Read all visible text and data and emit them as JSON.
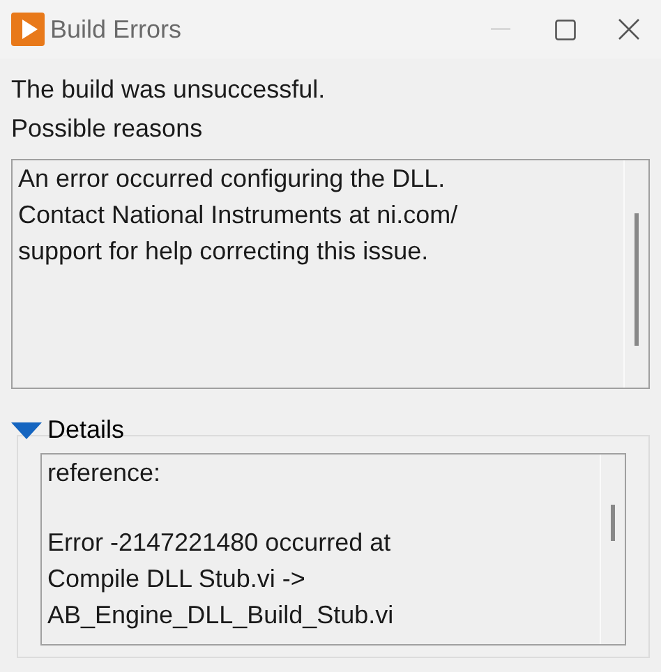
{
  "window": {
    "title": "Build Errors",
    "title_buttons": [
      {
        "kind": "minimize",
        "disabled": true
      },
      {
        "kind": "maximize",
        "disabled": false
      },
      {
        "kind": "close",
        "disabled": false
      }
    ]
  },
  "message": [
    "The build was unsuccessful.",
    "Possible reasons"
  ],
  "reasons_box": {
    "paragraphs": [
      {
        "lines": [
          "An error occurred configuring the DLL.",
          "Contact National Instruments at ni.com/",
          "support for help correcting this issue."
        ]
      }
    ]
  },
  "details": {
    "label": "Details",
    "expanded": true,
    "paragraphs": [
      {
        "lines": [
          "reference:"
        ]
      },
      {
        "lines": [
          "Error -2147221480 occurred at",
          "Compile DLL Stub.vi ->",
          "AB_Engine_DLL_Build_Stub.vi"
        ]
      }
    ]
  }
}
